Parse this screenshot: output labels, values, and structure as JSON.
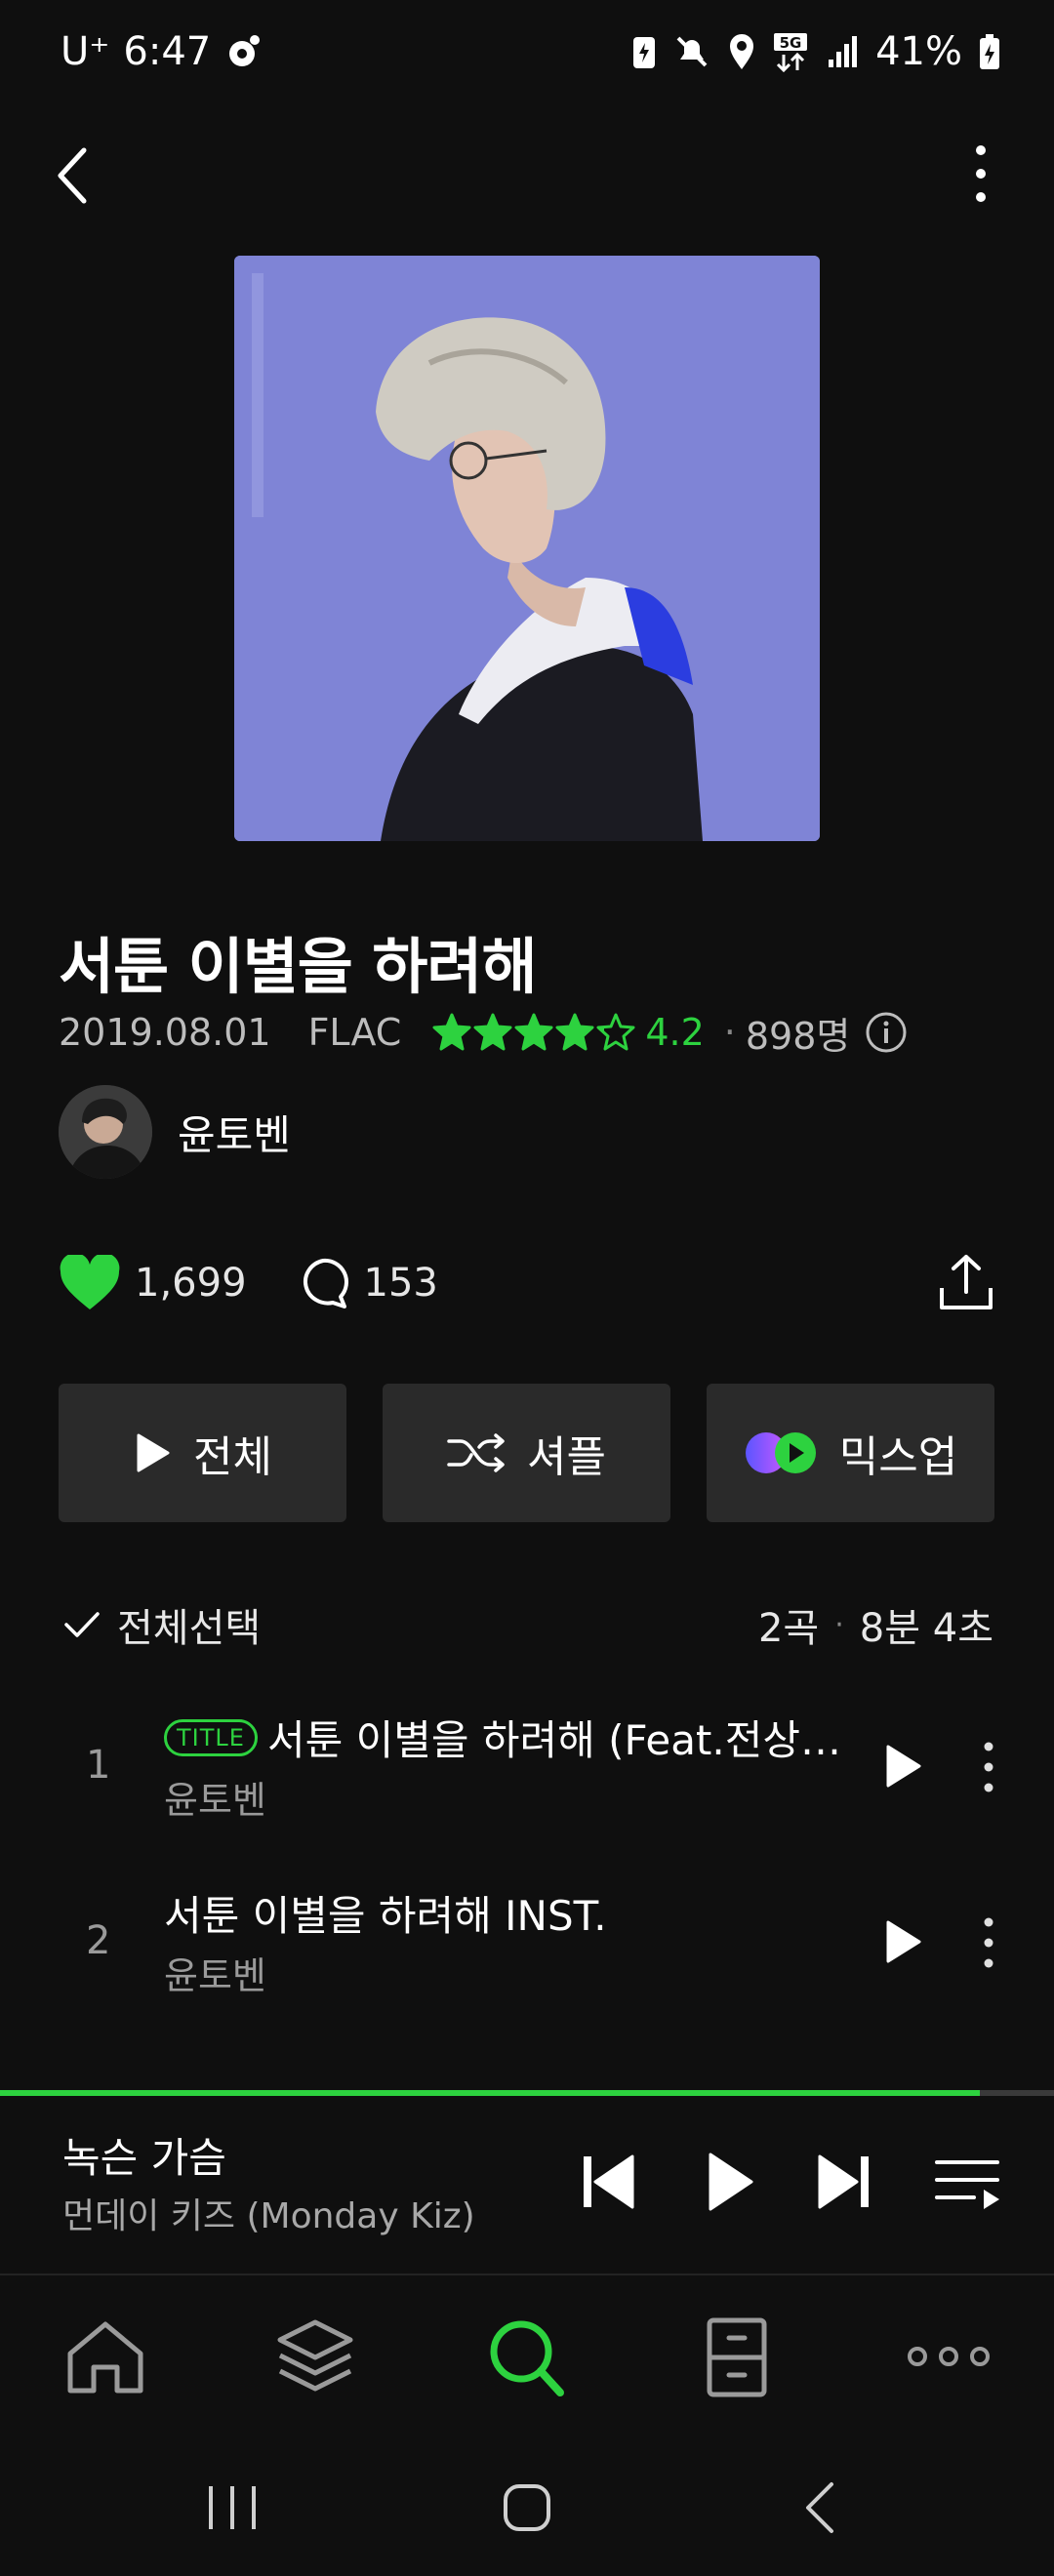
{
  "status_bar": {
    "carrier": "U⁺",
    "time": "6:47",
    "battery": "41%"
  },
  "album": {
    "title": "서툰 이별을 하려해",
    "date": "2019.08.01",
    "format": "FLAC",
    "rating": "4.2",
    "rating_value": 4.2,
    "rating_max": 5,
    "rating_count": "898명",
    "artist": "윤토벤",
    "likes": "1,699",
    "comments": "153"
  },
  "actions": {
    "play_all": "전체",
    "shuffle": "셔플",
    "mixup": "믹스업"
  },
  "tracklist": {
    "select_all": "전체선택",
    "count": "2곡",
    "duration": "8분 4초",
    "tracks": [
      {
        "num": "1",
        "badge": "TITLE",
        "title": "서툰 이별을 하려해 (Feat.전상…",
        "artist": "윤토벤"
      },
      {
        "num": "2",
        "badge": "",
        "title": "서툰 이별을 하려해 INST.",
        "artist": "윤토벤"
      }
    ]
  },
  "now_playing": {
    "title": "녹슨 가슴",
    "artist": "먼데이 키즈 (Monday Kiz)",
    "progress": 0.93
  },
  "colors": {
    "accent": "#2dd23f",
    "background": "#0f0f0f",
    "button_bg": "#2a2a2a",
    "cover_bg": "#7f84d6"
  },
  "icons": [
    "back-icon",
    "more-vertical-icon",
    "star-icon",
    "info-icon",
    "heart-icon",
    "comment-icon",
    "share-icon",
    "play-icon",
    "shuffle-icon",
    "mixup-icon",
    "check-icon",
    "skip-previous-icon",
    "skip-next-icon",
    "playlist-icon",
    "home-icon",
    "layers-icon",
    "search-icon",
    "storage-icon",
    "more-horizontal-icon"
  ]
}
